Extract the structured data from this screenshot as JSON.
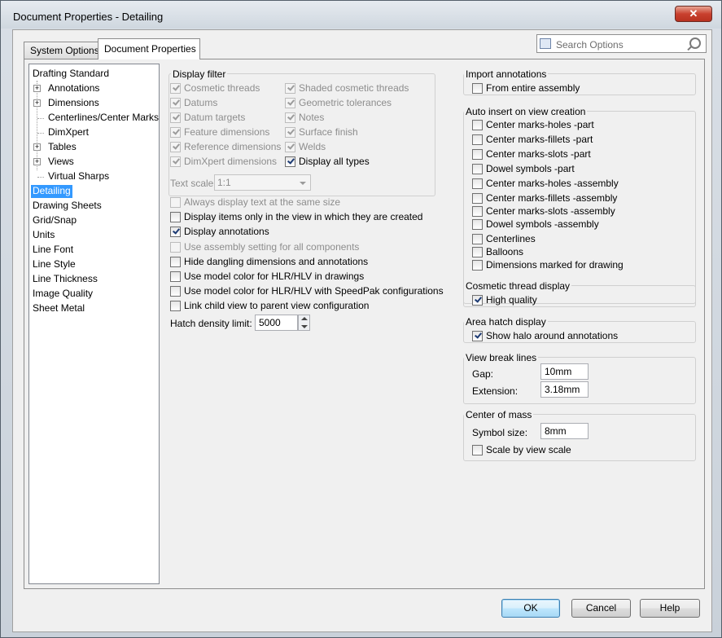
{
  "window": {
    "title": "Document Properties - Detailing",
    "close_label": "✕"
  },
  "tabs": [
    {
      "label": "System Options",
      "active": false
    },
    {
      "label": "Document Properties",
      "active": true
    }
  ],
  "search": {
    "placeholder": "Search Options"
  },
  "tree": {
    "items": [
      {
        "label": "Drafting Standard",
        "expandable": false,
        "level": 0
      },
      {
        "label": "Annotations",
        "expandable": true,
        "level": 1
      },
      {
        "label": "Dimensions",
        "expandable": true,
        "level": 1
      },
      {
        "label": "Centerlines/Center Marks",
        "expandable": false,
        "level": 1
      },
      {
        "label": "DimXpert",
        "expandable": false,
        "level": 1
      },
      {
        "label": "Tables",
        "expandable": true,
        "level": 1
      },
      {
        "label": "Views",
        "expandable": true,
        "level": 1
      },
      {
        "label": "Virtual Sharps",
        "expandable": false,
        "level": 1
      },
      {
        "label": "Detailing",
        "selected": true,
        "level": 0
      },
      {
        "label": "Drawing Sheets",
        "level": 0
      },
      {
        "label": "Grid/Snap",
        "level": 0
      },
      {
        "label": "Units",
        "level": 0
      },
      {
        "label": "Line Font",
        "level": 0
      },
      {
        "label": "Line Style",
        "level": 0
      },
      {
        "label": "Line Thickness",
        "level": 0
      },
      {
        "label": "Image Quality",
        "level": 0
      },
      {
        "label": "Sheet Metal",
        "level": 0
      }
    ]
  },
  "display_filter": {
    "title": "Display filter",
    "left": [
      {
        "label": "Cosmetic threads",
        "checked": true,
        "disabled": true
      },
      {
        "label": "Datums",
        "checked": true,
        "disabled": true
      },
      {
        "label": "Datum targets",
        "checked": true,
        "disabled": true
      },
      {
        "label": "Feature dimensions",
        "checked": true,
        "disabled": true
      },
      {
        "label": "Reference dimensions",
        "checked": true,
        "disabled": true
      },
      {
        "label": "DimXpert dimensions",
        "checked": true,
        "disabled": true
      }
    ],
    "right": [
      {
        "label": "Shaded cosmetic threads",
        "checked": true,
        "disabled": true
      },
      {
        "label": "Geometric tolerances",
        "checked": true,
        "disabled": true
      },
      {
        "label": "Notes",
        "checked": true,
        "disabled": true
      },
      {
        "label": "Surface finish",
        "checked": true,
        "disabled": true
      },
      {
        "label": "Welds",
        "checked": true,
        "disabled": true
      },
      {
        "label": "Display all types",
        "checked": true,
        "disabled": false
      }
    ]
  },
  "text_scale": {
    "label": "Text scale:",
    "value": "1:1"
  },
  "options": [
    {
      "label": "Always display text at the same size",
      "checked": false,
      "disabled": true
    },
    {
      "label": "Display items only in the view in which they are created",
      "checked": false,
      "disabled": false
    },
    {
      "label": "Display annotations",
      "checked": true,
      "disabled": false
    },
    {
      "label": "Use assembly setting for all components",
      "checked": false,
      "disabled": true
    },
    {
      "label": "Hide dangling dimensions and annotations",
      "checked": false,
      "disabled": false
    },
    {
      "label": "Use model color for HLR/HLV in drawings",
      "checked": false,
      "disabled": false
    },
    {
      "label": "Use model color for HLR/HLV with SpeedPak configurations",
      "checked": false,
      "disabled": false
    },
    {
      "label": "Link child view to parent view configuration",
      "checked": false,
      "disabled": false
    }
  ],
  "hatch": {
    "label": "Hatch density limit:",
    "value": "5000"
  },
  "import_annotations": {
    "title": "Import annotations",
    "items": [
      {
        "label": "From entire assembly",
        "checked": false
      }
    ]
  },
  "auto_insert": {
    "title": "Auto insert on view creation",
    "items": [
      {
        "label": "Center marks-holes -part",
        "checked": false
      },
      {
        "label": "Center marks-fillets -part",
        "checked": false
      },
      {
        "label": "Center marks-slots  -part",
        "checked": false
      },
      {
        "label": "Dowel symbols -part",
        "checked": false
      },
      {
        "label": "Center marks-holes -assembly",
        "checked": false
      },
      {
        "label": "Center marks-fillets -assembly",
        "checked": false
      },
      {
        "label": "Center marks-slots  -assembly",
        "checked": false
      },
      {
        "label": "Dowel symbols -assembly",
        "checked": false
      },
      {
        "label": "Centerlines",
        "checked": false
      },
      {
        "label": "Balloons",
        "checked": false
      },
      {
        "label": "Dimensions marked for drawing",
        "checked": false
      }
    ]
  },
  "cosmetic_thread": {
    "title": "Cosmetic thread display",
    "items": [
      {
        "label": "High quality",
        "checked": true
      }
    ]
  },
  "area_hatch": {
    "title": "Area hatch display",
    "items": [
      {
        "label": "Show halo around annotations",
        "checked": true
      }
    ]
  },
  "view_break": {
    "title": "View break lines",
    "gap_label": "Gap:",
    "gap_value": "10mm",
    "ext_label": "Extension:",
    "ext_value": "3.18mm"
  },
  "center_mass": {
    "title": "Center of mass",
    "size_label": "Symbol size:",
    "size_value": "8mm",
    "items": [
      {
        "label": "Scale by view scale",
        "checked": false
      }
    ]
  },
  "buttons": {
    "ok": "OK",
    "cancel": "Cancel",
    "help": "Help"
  }
}
